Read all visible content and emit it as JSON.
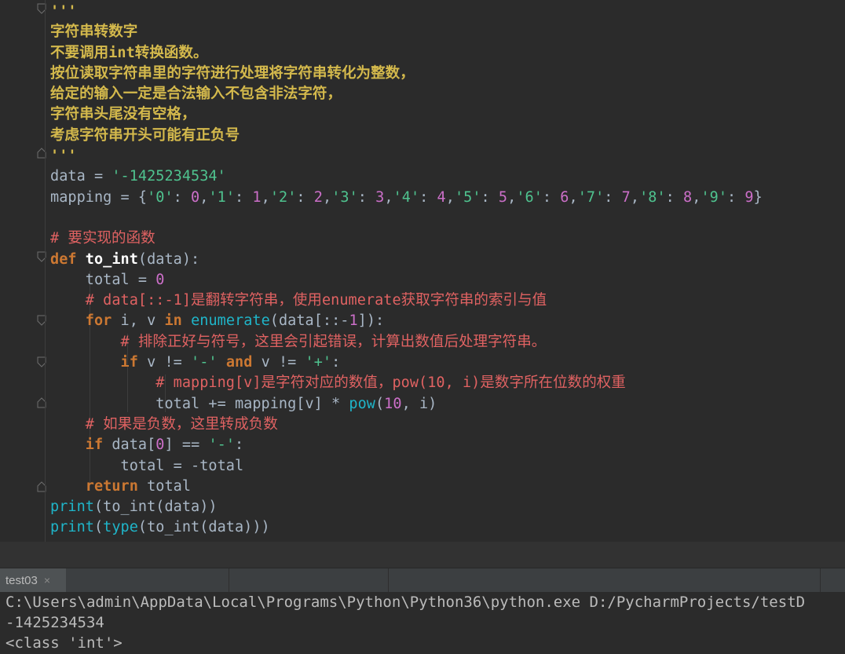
{
  "editor": {
    "lines": [
      [
        {
          "t": "'''",
          "c": "doc"
        }
      ],
      [
        {
          "t": "字符串转数字",
          "c": "doc cn"
        }
      ],
      [
        {
          "t": "不要调用",
          "c": "doc cn"
        },
        {
          "t": "int",
          "c": "doc"
        },
        {
          "t": "转换函数。",
          "c": "doc cn"
        }
      ],
      [
        {
          "t": "按位读取字符串里的字符进行处理将字符串转化为整数，",
          "c": "doc cn"
        }
      ],
      [
        {
          "t": "给定的输入一定是合法输入不包含非法字符，",
          "c": "doc cn"
        }
      ],
      [
        {
          "t": "字符串头尾没有空格，",
          "c": "doc cn"
        }
      ],
      [
        {
          "t": "考虑字符串开头可能有正负号",
          "c": "doc cn"
        }
      ],
      [
        {
          "t": "'''",
          "c": "doc"
        }
      ],
      [
        {
          "t": "data",
          "c": "var"
        },
        {
          "t": " = ",
          "c": "var"
        },
        {
          "t": "'-1425234534'",
          "c": "str"
        }
      ],
      [
        {
          "t": "mapping = {",
          "c": "var"
        },
        {
          "t": "'0'",
          "c": "str"
        },
        {
          "t": ": ",
          "c": "var"
        },
        {
          "t": "0",
          "c": "num"
        },
        {
          "t": ",",
          "c": "var"
        },
        {
          "t": "'1'",
          "c": "str"
        },
        {
          "t": ": ",
          "c": "var"
        },
        {
          "t": "1",
          "c": "num"
        },
        {
          "t": ",",
          "c": "var"
        },
        {
          "t": "'2'",
          "c": "str"
        },
        {
          "t": ": ",
          "c": "var"
        },
        {
          "t": "2",
          "c": "num"
        },
        {
          "t": ",",
          "c": "var"
        },
        {
          "t": "'3'",
          "c": "str"
        },
        {
          "t": ": ",
          "c": "var"
        },
        {
          "t": "3",
          "c": "num"
        },
        {
          "t": ",",
          "c": "var"
        },
        {
          "t": "'4'",
          "c": "str"
        },
        {
          "t": ": ",
          "c": "var"
        },
        {
          "t": "4",
          "c": "num"
        },
        {
          "t": ",",
          "c": "var"
        },
        {
          "t": "'5'",
          "c": "str"
        },
        {
          "t": ": ",
          "c": "var"
        },
        {
          "t": "5",
          "c": "num"
        },
        {
          "t": ",",
          "c": "var"
        },
        {
          "t": "'6'",
          "c": "str"
        },
        {
          "t": ": ",
          "c": "var"
        },
        {
          "t": "6",
          "c": "num"
        },
        {
          "t": ",",
          "c": "var"
        },
        {
          "t": "'7'",
          "c": "str"
        },
        {
          "t": ": ",
          "c": "var"
        },
        {
          "t": "7",
          "c": "num"
        },
        {
          "t": ",",
          "c": "var"
        },
        {
          "t": "'8'",
          "c": "str"
        },
        {
          "t": ": ",
          "c": "var"
        },
        {
          "t": "8",
          "c": "num"
        },
        {
          "t": ",",
          "c": "var"
        },
        {
          "t": "'9'",
          "c": "str"
        },
        {
          "t": ": ",
          "c": "var"
        },
        {
          "t": "9",
          "c": "num"
        },
        {
          "t": "}",
          "c": "var"
        }
      ],
      [],
      [
        {
          "t": "# ",
          "c": "cmt"
        },
        {
          "t": "要实现的函数",
          "c": "cmt cn"
        }
      ],
      [
        {
          "t": "def ",
          "c": "kw"
        },
        {
          "t": "to_int",
          "c": "fn"
        },
        {
          "t": "(data):",
          "c": "var"
        }
      ],
      [
        {
          "t": "    total = ",
          "c": "var"
        },
        {
          "t": "0",
          "c": "num"
        }
      ],
      [
        {
          "t": "    # data[::-1]",
          "c": "cmt"
        },
        {
          "t": "是翻转字符串，使用",
          "c": "cmt cn"
        },
        {
          "t": "enumerate",
          "c": "cmt"
        },
        {
          "t": "获取字符串的索引与值",
          "c": "cmt cn"
        }
      ],
      [
        {
          "t": "    ",
          "c": "var"
        },
        {
          "t": "for ",
          "c": "kw"
        },
        {
          "t": "i, v ",
          "c": "var"
        },
        {
          "t": "in ",
          "c": "kw"
        },
        {
          "t": "enumerate",
          "c": "bi"
        },
        {
          "t": "(data[::-",
          "c": "var"
        },
        {
          "t": "1",
          "c": "num"
        },
        {
          "t": "]):",
          "c": "var"
        }
      ],
      [
        {
          "t": "        # ",
          "c": "cmt"
        },
        {
          "t": "排除正好与符号，这里会引起错误，计算出数值后处理字符串。",
          "c": "cmt cn"
        }
      ],
      [
        {
          "t": "        ",
          "c": "var"
        },
        {
          "t": "if ",
          "c": "kw"
        },
        {
          "t": "v != ",
          "c": "var"
        },
        {
          "t": "'-' ",
          "c": "str"
        },
        {
          "t": "and ",
          "c": "kw"
        },
        {
          "t": "v != ",
          "c": "var"
        },
        {
          "t": "'+'",
          "c": "str"
        },
        {
          "t": ":",
          "c": "var"
        }
      ],
      [
        {
          "t": "            # mapping[v]",
          "c": "cmt"
        },
        {
          "t": "是字符对应的数值，",
          "c": "cmt cn"
        },
        {
          "t": "pow(10, i)",
          "c": "cmt"
        },
        {
          "t": "是数字所在位数的权重",
          "c": "cmt cn"
        }
      ],
      [
        {
          "t": "            total += mapping[v] * ",
          "c": "var"
        },
        {
          "t": "pow",
          "c": "bi"
        },
        {
          "t": "(",
          "c": "var"
        },
        {
          "t": "10",
          "c": "num"
        },
        {
          "t": ", i)",
          "c": "var"
        }
      ],
      [
        {
          "t": "    # ",
          "c": "cmt"
        },
        {
          "t": "如果是负数，这里转成负数",
          "c": "cmt cn"
        }
      ],
      [
        {
          "t": "    ",
          "c": "var"
        },
        {
          "t": "if ",
          "c": "kw"
        },
        {
          "t": "data[",
          "c": "var"
        },
        {
          "t": "0",
          "c": "num"
        },
        {
          "t": "] == ",
          "c": "var"
        },
        {
          "t": "'-'",
          "c": "str"
        },
        {
          "t": ":",
          "c": "var"
        }
      ],
      [
        {
          "t": "        total = -total",
          "c": "var"
        }
      ],
      [
        {
          "t": "    ",
          "c": "var"
        },
        {
          "t": "return ",
          "c": "kw"
        },
        {
          "t": "total",
          "c": "var"
        }
      ],
      [
        {
          "t": "print",
          "c": "bi"
        },
        {
          "t": "(to_int(data))",
          "c": "var"
        }
      ],
      [
        {
          "t": "print",
          "c": "bi"
        },
        {
          "t": "(",
          "c": "var"
        },
        {
          "t": "type",
          "c": "bi"
        },
        {
          "t": "(to_int(data)))",
          "c": "var"
        }
      ]
    ]
  },
  "run_panel": {
    "tab_label": "test03",
    "tab_close": "×",
    "console_lines": [
      "C:\\Users\\admin\\AppData\\Local\\Programs\\Python\\Python36\\python.exe D:/PycharmProjects/testD",
      "-1425234534",
      "<class 'int'>"
    ]
  }
}
